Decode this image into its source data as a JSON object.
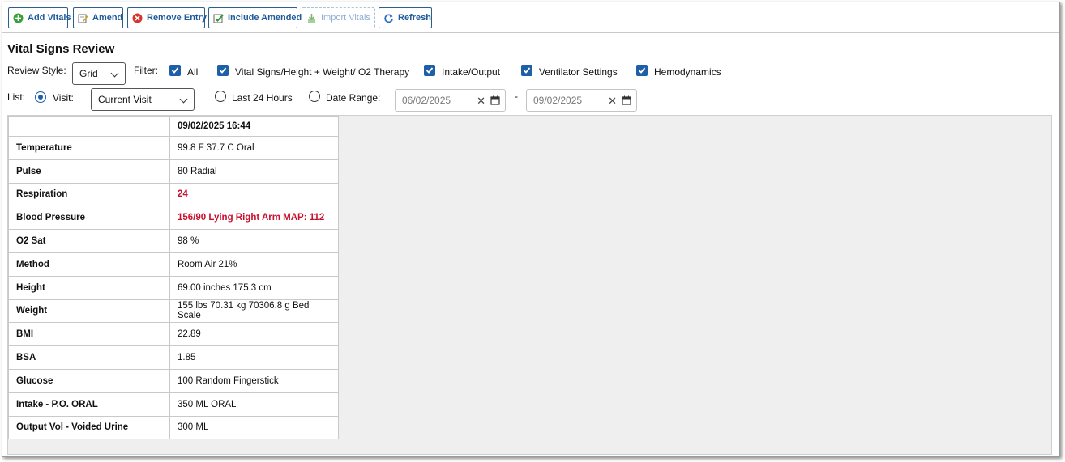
{
  "toolbar": {
    "buttons": [
      {
        "label": "Add Vitals",
        "icon": "plus-circle-icon"
      },
      {
        "label": "Amend",
        "icon": "edit-icon"
      },
      {
        "label": "Remove Entry",
        "icon": "remove-icon"
      },
      {
        "label": "Include Amended",
        "icon": "check-edit-icon"
      },
      {
        "label": "Import Vitals",
        "icon": "import-icon",
        "disabled": true
      },
      {
        "label": "Refresh",
        "icon": "refresh-icon"
      }
    ]
  },
  "page": {
    "title": "Vital Signs Review"
  },
  "review_style": {
    "label": "Review Style:",
    "value": "Grid"
  },
  "filter": {
    "label": "Filter:",
    "options": [
      {
        "label": "All",
        "checked": true
      },
      {
        "label": "Vital Signs/Height + Weight/ O2 Therapy",
        "checked": true
      },
      {
        "label": "Intake/Output",
        "checked": true
      },
      {
        "label": "Ventilator Settings",
        "checked": true
      },
      {
        "label": "Hemodynamics",
        "checked": true
      }
    ]
  },
  "list": {
    "label": "List:",
    "visit_label": "Visit:",
    "visit_value": "Current Visit",
    "last24_label": "Last 24 Hours",
    "date_range_label": "Date Range:",
    "date_from": "06/02/2025",
    "date_sep": "-",
    "date_to": "09/02/2025",
    "selected": "visit"
  },
  "grid": {
    "column_header": "09/02/2025 16:44",
    "rows": [
      {
        "name": "Temperature",
        "value": "99.8 F 37.7 C Oral",
        "abnormal": false
      },
      {
        "name": "Pulse",
        "value": "80 Radial",
        "abnormal": false
      },
      {
        "name": "Respiration",
        "value": "24",
        "abnormal": true
      },
      {
        "name": "Blood Pressure",
        "value": "156/90 Lying Right Arm MAP: 112",
        "abnormal": true
      },
      {
        "name": "O2 Sat",
        "value": "98 %",
        "abnormal": false
      },
      {
        "name": "Method",
        "value": "Room Air 21%",
        "abnormal": false
      },
      {
        "name": "Height",
        "value": "69.00 inches 175.3 cm",
        "abnormal": false
      },
      {
        "name": "Weight",
        "value": "155 lbs 70.31 kg 70306.8 g Bed Scale",
        "abnormal": false
      },
      {
        "name": "BMI",
        "value": "22.89",
        "abnormal": false
      },
      {
        "name": "BSA",
        "value": "1.85",
        "abnormal": false
      },
      {
        "name": "Glucose",
        "value": "100 Random Fingerstick",
        "abnormal": false
      },
      {
        "name": "Intake - P.O. ORAL",
        "value": "350 ML ORAL",
        "abnormal": false
      },
      {
        "name": "Output Vol - Voided Urine",
        "value": "300 ML",
        "abnormal": false
      }
    ]
  },
  "colors": {
    "accent": "#1f5fa8",
    "abnormal": "#c8102e",
    "button_text": "#1f5a99"
  }
}
